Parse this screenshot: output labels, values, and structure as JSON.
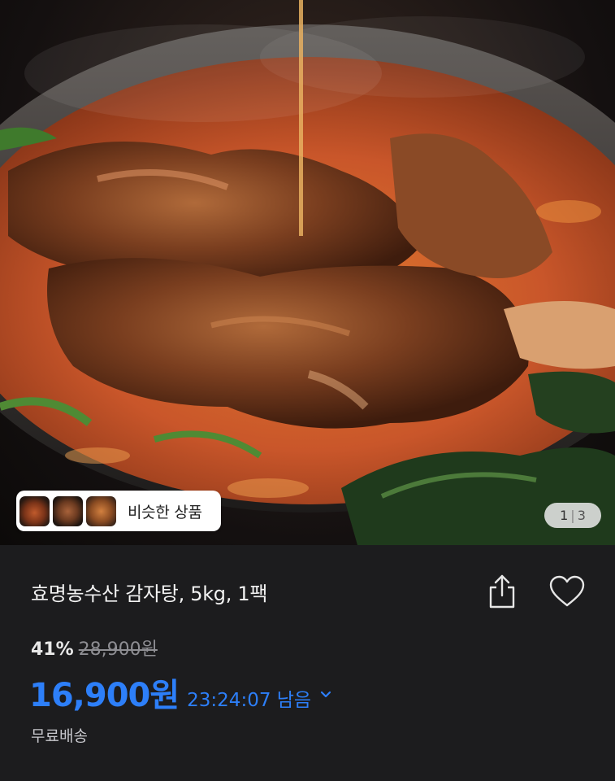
{
  "hero": {
    "similar_products_label": "비슷한 상품",
    "thumbnails": [
      "similar-product-1",
      "similar-product-2",
      "similar-product-3"
    ],
    "page_current": "1",
    "page_total": "3"
  },
  "product": {
    "title": "효명농수산 감자탕, 5kg, 1팩",
    "discount_rate": "41%",
    "original_price": "28,900원",
    "sale_price": "16,900원",
    "timer": "23:24:07 남음",
    "shipping": "무료배송"
  },
  "icons": {
    "share": "share-icon",
    "wishlist": "heart-icon",
    "timer_toggle": "chevron-down-icon"
  },
  "colors": {
    "background": "#1c1c1e",
    "accent": "#2d7ff9",
    "muted": "#8e8e93"
  }
}
